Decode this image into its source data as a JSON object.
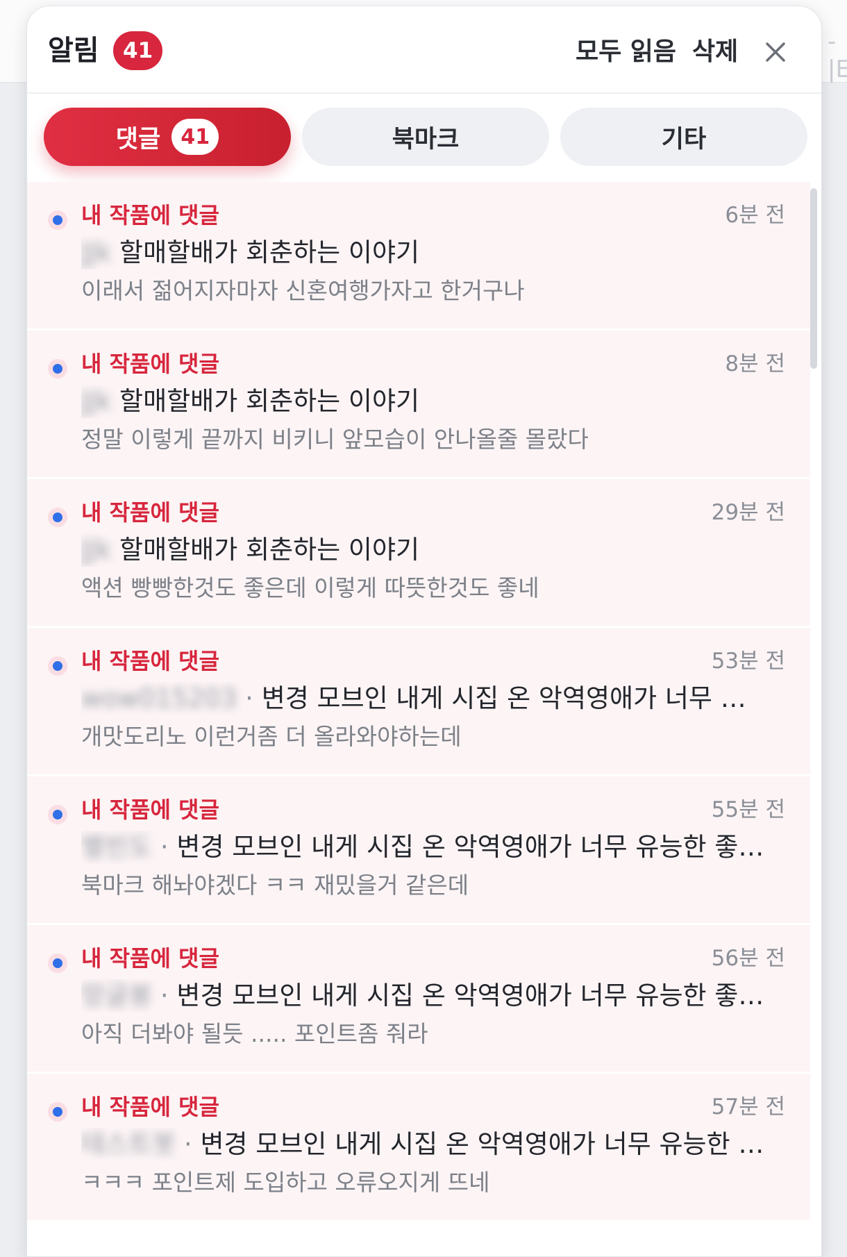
{
  "background": {
    "fragment": "-|E"
  },
  "header": {
    "title": "알림",
    "badge": "41",
    "read_all": "모두 읽음",
    "delete": "삭제"
  },
  "tabs": [
    {
      "label": "댓글",
      "count": "41",
      "active": true
    },
    {
      "label": "북마크",
      "active": false
    },
    {
      "label": "기타",
      "active": false
    }
  ],
  "notifications": [
    {
      "type": "내 작품에 댓글",
      "time": "6분 전",
      "author": "JJk",
      "title": "할매할배가 회춘하는 이야기",
      "body": "이래서 젊어지자마자 신혼여행가자고 한거구나"
    },
    {
      "type": "내 작품에 댓글",
      "time": "8분 전",
      "author": "JJk",
      "title": "할매할배가 회춘하는 이야기",
      "body": "정말 이렇게 끝까지 비키니 앞모습이 안나올줄 몰랐다"
    },
    {
      "type": "내 작품에 댓글",
      "time": "29분 전",
      "author": "JJk",
      "title": "할매할배가 회춘하는 이야기",
      "body": "액션 빵빵한것도 좋은데 이렇게 따뜻한것도 좋네"
    },
    {
      "type": "내 작품에 댓글",
      "time": "53분 전",
      "author": "wow015203",
      "title": "변경 모브인 내게 시집 온 악역영애가 너무 유능한 좋은 아내",
      "body": "개맛도리노 이런거좀 더 올라와야하는데"
    },
    {
      "type": "내 작품에 댓글",
      "time": "55분 전",
      "author": "별빈도",
      "title": "변경 모브인 내게 시집 온 악역영애가 너무 유능한 좋은 아내",
      "body": "북마크 해놔야겠다 ㅋㅋ 재밌을거 같은데"
    },
    {
      "type": "내 작품에 댓글",
      "time": "56분 전",
      "author": "망글봉",
      "title": "변경 모브인 내게 시집 온 악역영애가 너무 유능한 좋은 아내",
      "body": "아직 더봐야 될듯 ..... 포인트좀 줘라"
    },
    {
      "type": "내 작품에 댓글",
      "time": "57분 전",
      "author": "테스트봇",
      "title": "변경 모브인 내게 시집 온 악역영애가 너무 유능한 좋은 아내",
      "body": "ㅋㅋㅋ 포인트제 도입하고 오류오지게 뜨네"
    }
  ],
  "colors": {
    "accent": "#d7263d",
    "unread_dot": "#2f6fe8",
    "item_bg": "#fcf4f5"
  },
  "icons": {
    "close": "close-icon",
    "unread": "unread-dot-icon"
  }
}
